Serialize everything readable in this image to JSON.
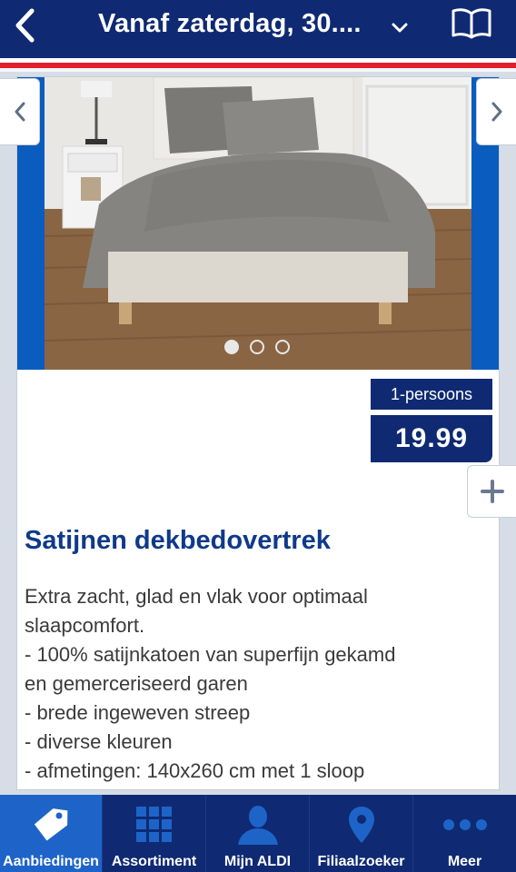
{
  "header": {
    "title": "Vanaf zaterdag, 30....",
    "back_icon": "chevron-left-icon",
    "dropdown_icon": "chevron-down-icon",
    "catalog_icon": "open-book-icon"
  },
  "carousel": {
    "slide_count": 3,
    "active_slide": 1,
    "image_alt": "bed with grey satin duvet cover"
  },
  "product": {
    "unit_label": "1-persoons",
    "price": "19.99",
    "title": "Satijnen dekbedovertrek",
    "description_lines": [
      "Extra zacht, glad en vlak voor optimaal",
      "slaapcomfort.",
      "- 100% satijnkatoen van superfijn gekamd",
      "en gemerceriseerd garen",
      "- brede ingeweven streep",
      "- diverse kleuren",
      "- afmetingen: 140x260 cm met 1 sloop"
    ]
  },
  "tabs": [
    {
      "label": "Aanbiedingen",
      "icon": "tag-icon",
      "active": true
    },
    {
      "label": "Assortiment",
      "icon": "grid-icon",
      "active": false
    },
    {
      "label": "Mijn ALDI",
      "icon": "person-icon",
      "active": false
    },
    {
      "label": "Filiaalzoeker",
      "icon": "location-pin-icon",
      "active": false
    },
    {
      "label": "Meer",
      "icon": "more-dots-icon",
      "active": false
    }
  ],
  "colors": {
    "brand_blue": "#0f2a73",
    "active_tab": "#1e64c8",
    "accent_red": "#e2202c",
    "title_blue": "#0f3a8a"
  }
}
